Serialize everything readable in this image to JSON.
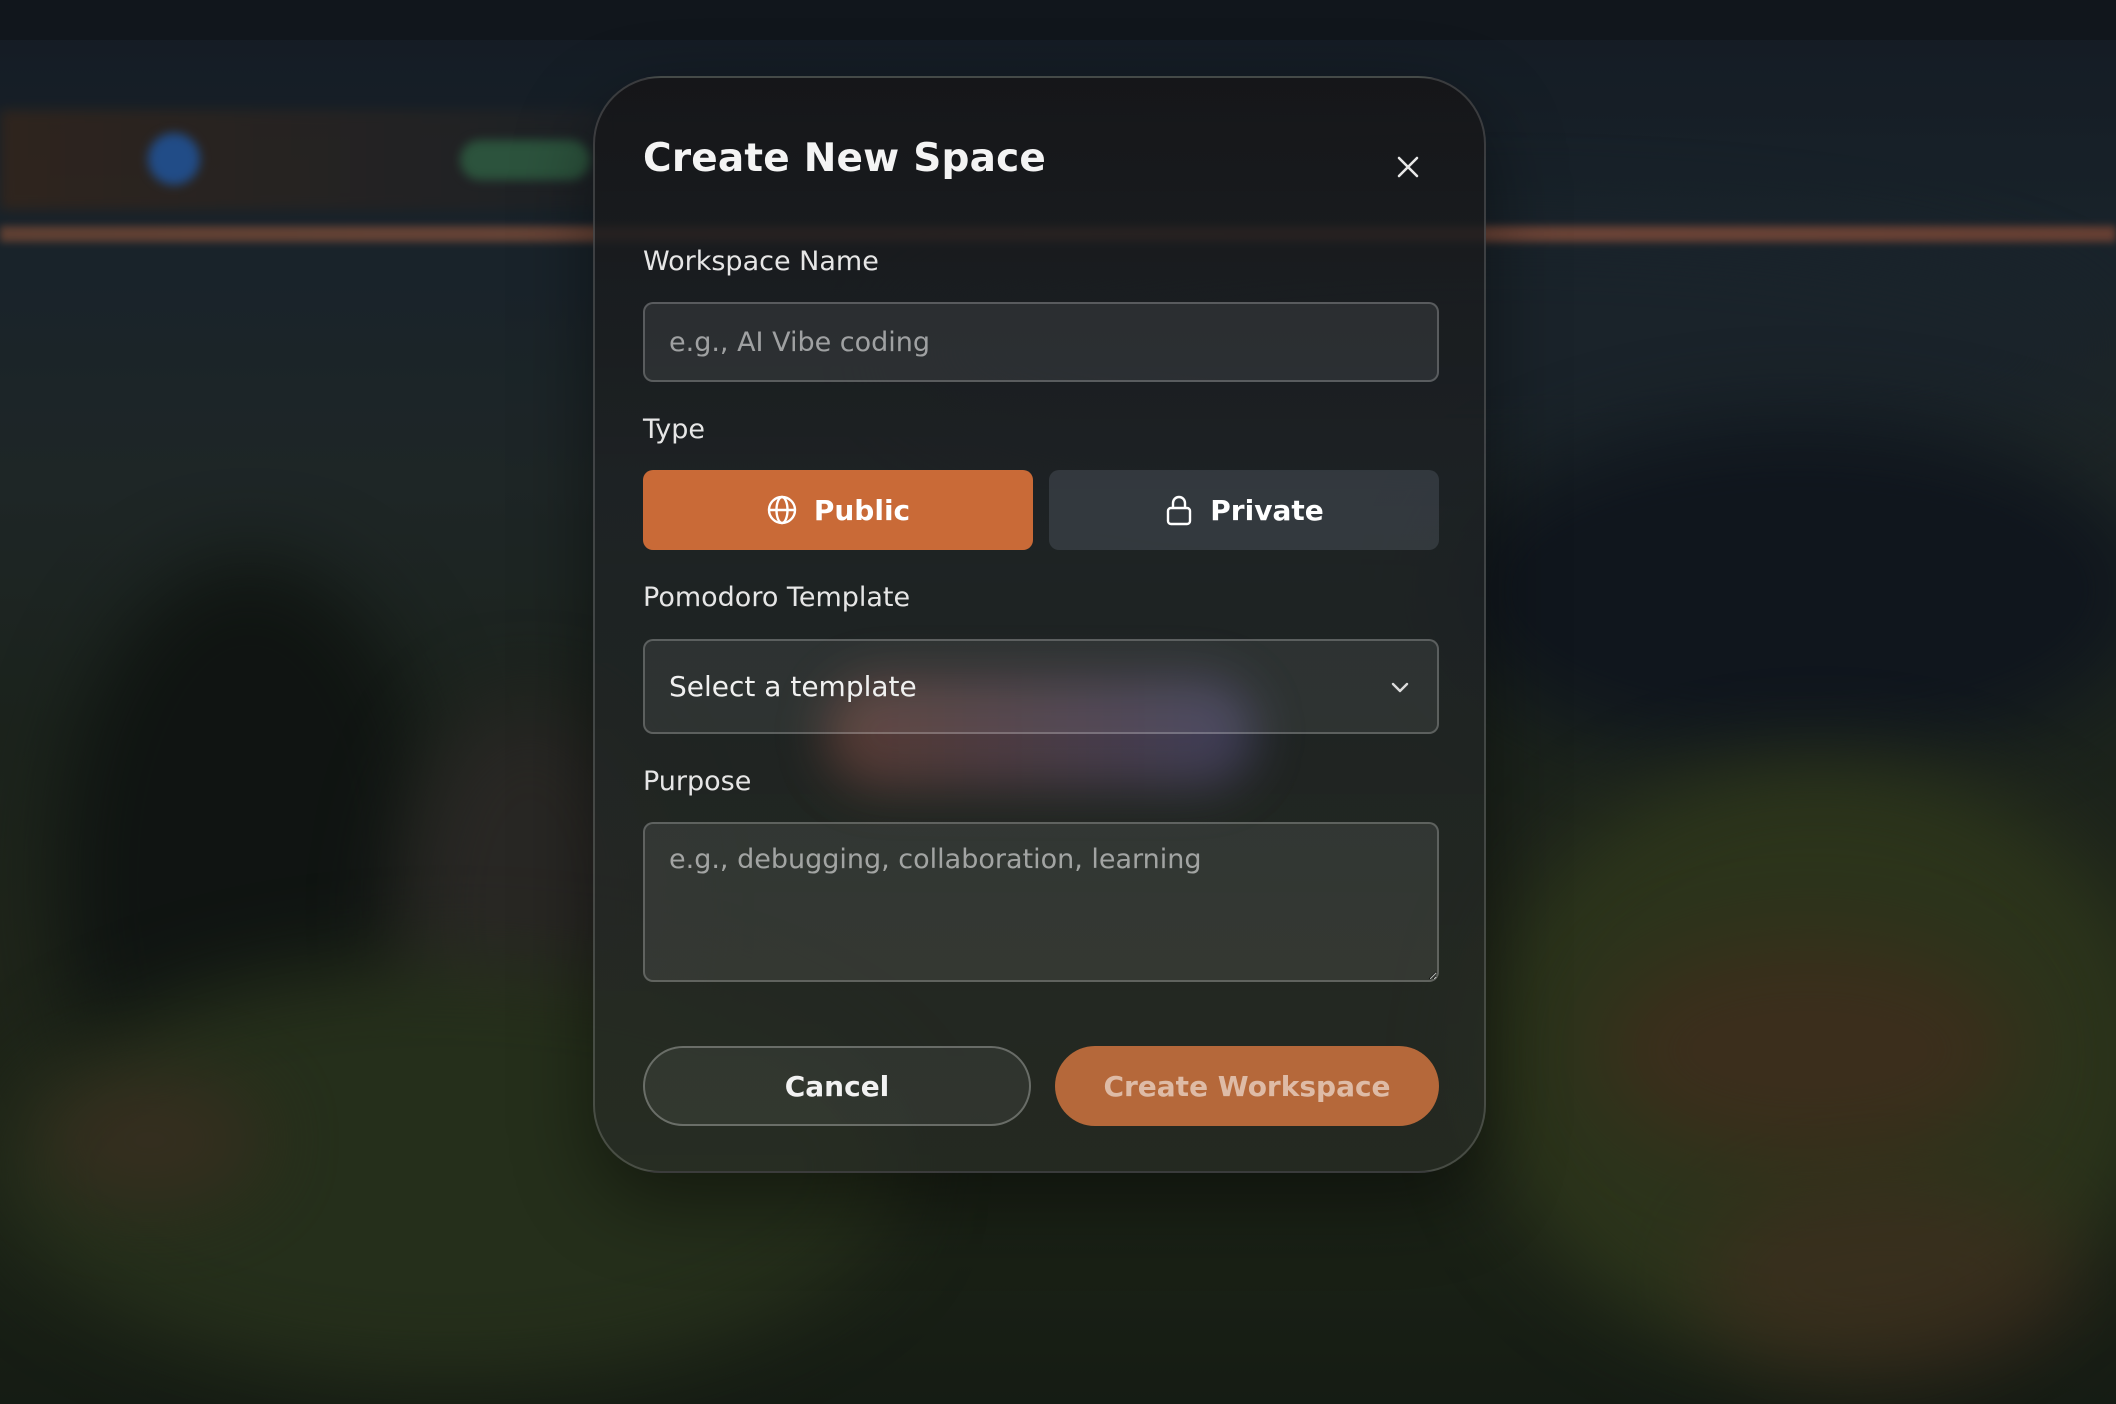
{
  "modal": {
    "title": "Create New Space",
    "close_icon": "close-icon"
  },
  "form": {
    "workspace_name": {
      "label": "Workspace Name",
      "value": "",
      "placeholder": "e.g., AI Vibe coding"
    },
    "type": {
      "label": "Type",
      "selected": "Public",
      "options": [
        {
          "label": "Public",
          "icon": "globe-icon"
        },
        {
          "label": "Private",
          "icon": "lock-icon"
        }
      ]
    },
    "pomodoro_template": {
      "label": "Pomodoro Template",
      "selected_value": "Select a template",
      "icon": "chevron-down-icon"
    },
    "purpose": {
      "label": "Purpose",
      "value": "",
      "placeholder": "e.g., debugging, collaboration, learning"
    }
  },
  "actions": {
    "cancel_label": "Cancel",
    "create_label": "Create Workspace"
  },
  "colors": {
    "accent": "#c96a37",
    "create_button": "#b5683a",
    "private_button": "#3b4048"
  }
}
